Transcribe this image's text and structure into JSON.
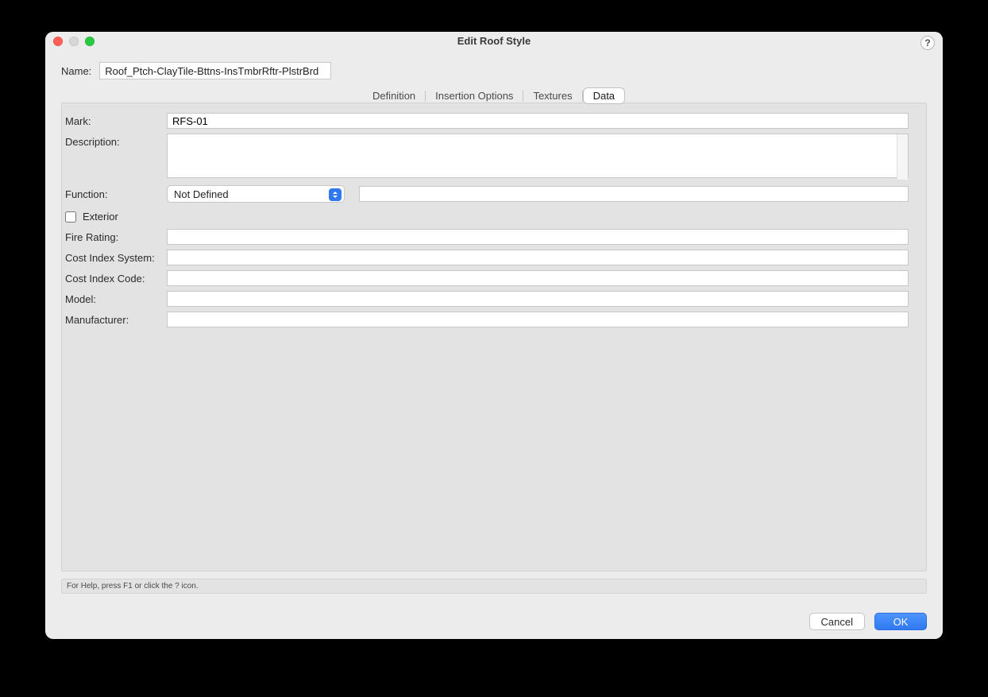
{
  "window": {
    "title": "Edit Roof Style",
    "help_glyph": "?"
  },
  "name_row": {
    "label": "Name:",
    "value": "Roof_Ptch-ClayTile-Bttns-InsTmbrRftr-PlstrBrd"
  },
  "tabs": {
    "items": [
      "Definition",
      "Insertion Options",
      "Textures",
      "Data"
    ],
    "active_index": 3
  },
  "data_tab": {
    "mark_label": "Mark:",
    "mark_value": "RFS-01",
    "description_label": "Description:",
    "description_value": "",
    "function_label": "Function:",
    "function_value": "Not Defined",
    "function_extra_value": "",
    "exterior_label": "Exterior",
    "exterior_checked": false,
    "fire_rating_label": "Fire Rating:",
    "fire_rating_value": "",
    "cost_index_system_label": "Cost Index System:",
    "cost_index_system_value": "",
    "cost_index_code_label": "Cost Index Code:",
    "cost_index_code_value": "",
    "model_label": "Model:",
    "model_value": "",
    "manufacturer_label": "Manufacturer:",
    "manufacturer_value": ""
  },
  "footer": {
    "help_hint": "For Help, press F1 or click the ? icon.",
    "cancel_label": "Cancel",
    "ok_label": "OK"
  }
}
